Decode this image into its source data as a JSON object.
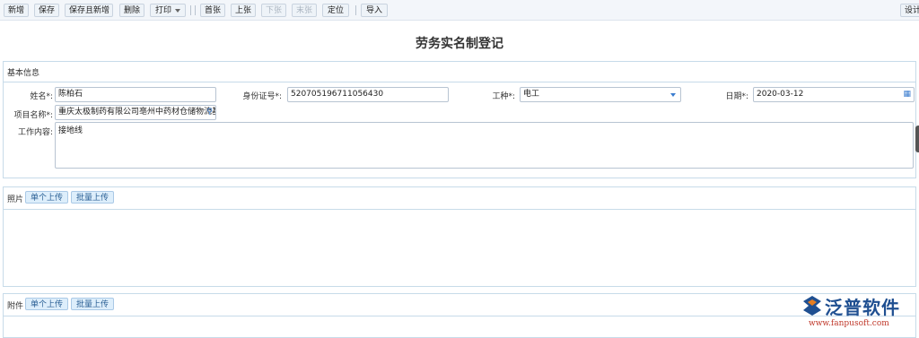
{
  "toolbar": {
    "new": "新增",
    "save": "保存",
    "save_new": "保存且新增",
    "delete": "删除",
    "print": "打印",
    "first": "首张",
    "prev": "上张",
    "next": "下张",
    "last": "末张",
    "locate": "定位",
    "import": "导入",
    "design": "设计"
  },
  "page_title": "劳务实名制登记",
  "basic": {
    "section_title": "基本信息",
    "name_label": "姓名*:",
    "name_value": "陈柏石",
    "id_label": "身份证号*:",
    "id_value": "520705196711056430",
    "trade_label": "工种*:",
    "trade_value": "电工",
    "date_label": "日期*:",
    "date_value": "2020-03-12",
    "project_label": "项目名称*:",
    "project_value": "重庆太极制药有限公司亳州中药材仓储物流基",
    "work_label": "工作内容:",
    "work_value": "接地线"
  },
  "photo": {
    "section_title": "照片",
    "single_upload": "单个上传",
    "batch_upload": "批量上传"
  },
  "attachment": {
    "section_title": "附件",
    "single_upload": "单个上传",
    "batch_upload": "批量上传"
  },
  "logo": {
    "text": "泛普软件",
    "url": "www.fanpusoft.com"
  },
  "colors": {
    "brand": "#1f4f91",
    "accent": "#3a7ccf",
    "panel_border": "#c7dbe9"
  }
}
